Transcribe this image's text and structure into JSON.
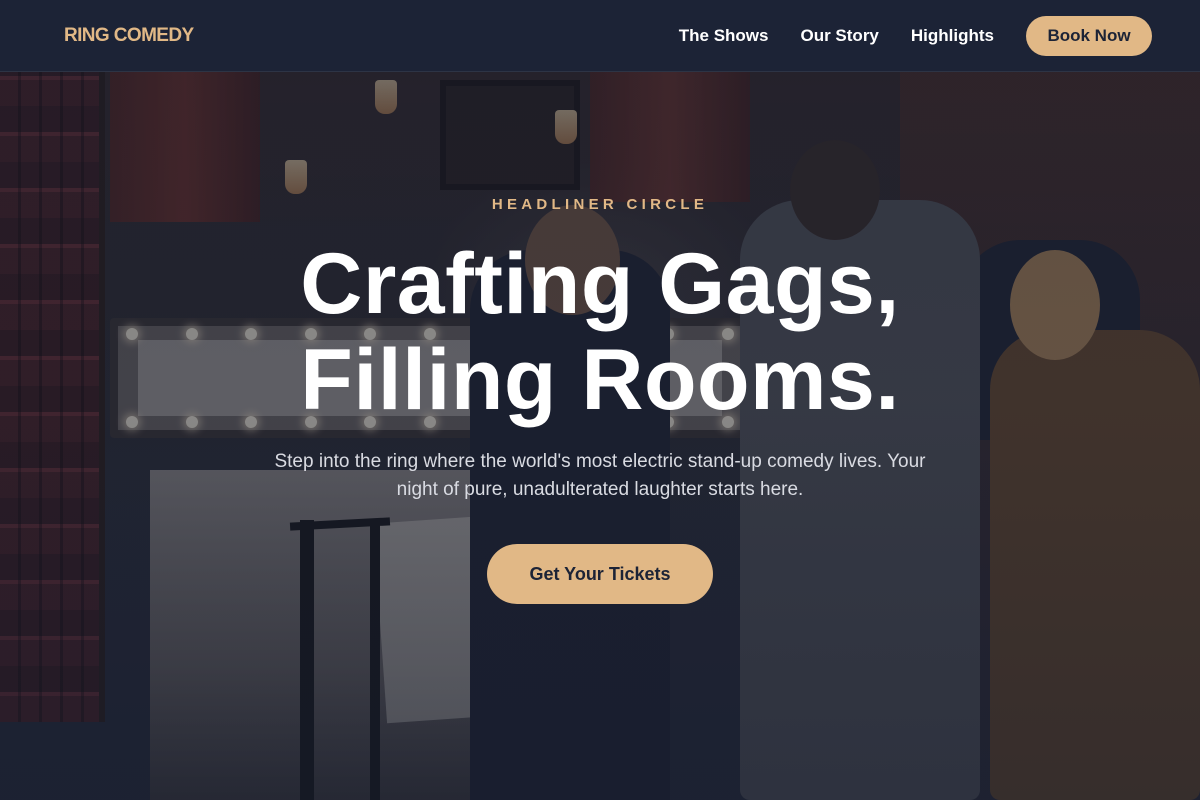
{
  "nav": {
    "brand": "RING COMEDY",
    "links": [
      {
        "label": "The Shows"
      },
      {
        "label": "Our Story"
      },
      {
        "label": "Highlights"
      }
    ],
    "cta_label": "Book Now"
  },
  "hero": {
    "eyebrow": "HEADLINER CIRCLE",
    "headline_line1": "Crafting Gags,",
    "headline_line2": "Filling Rooms.",
    "subtitle": "Step into the ring where the world's most electric stand-up comedy lives. Your night of pure, unadulterated laughter starts here.",
    "cta_label": "Get Your Tickets"
  },
  "colors": {
    "accent": "#e1b886",
    "nav_background": "#1c2336",
    "text": "#ffffff"
  }
}
